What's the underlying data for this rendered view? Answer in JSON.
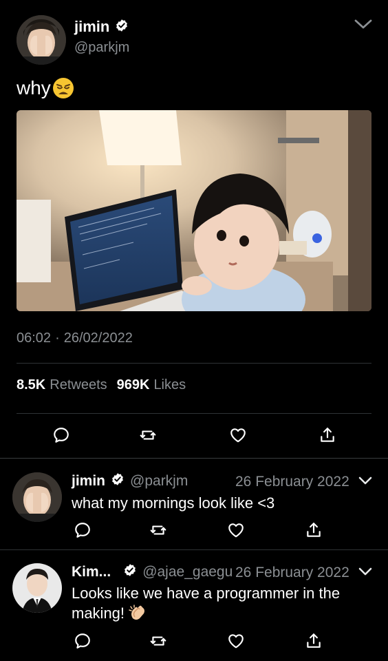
{
  "tweet": {
    "author_name": "jimin",
    "author_handle": "@parkjm",
    "text": "why",
    "emoji": "weary-face-emoji",
    "time": "06:02",
    "separator": "·",
    "date": "26/02/2022",
    "retweets_count": "8.5K",
    "retweets_label": "Retweets",
    "likes_count": "969K",
    "likes_label": "Likes"
  },
  "replies": [
    {
      "name": "jimin",
      "handle": "@parkjm",
      "date": "26 February 2022",
      "text": "what my mornings look like <3"
    },
    {
      "name": "Kim...",
      "handle": "@ajae_gaegu",
      "date": "26 February 2022",
      "text": "Looks like we have a programmer in the making!",
      "emoji": "clapping-hands-emoji"
    }
  ],
  "colors": {
    "background": "#000000",
    "text": "#ffffff",
    "muted": "#8b8f93",
    "divider": "#2f3336"
  },
  "icons": [
    "verified-badge-icon",
    "chevron-down-icon",
    "reply-icon",
    "retweet-icon",
    "like-icon",
    "share-icon"
  ]
}
